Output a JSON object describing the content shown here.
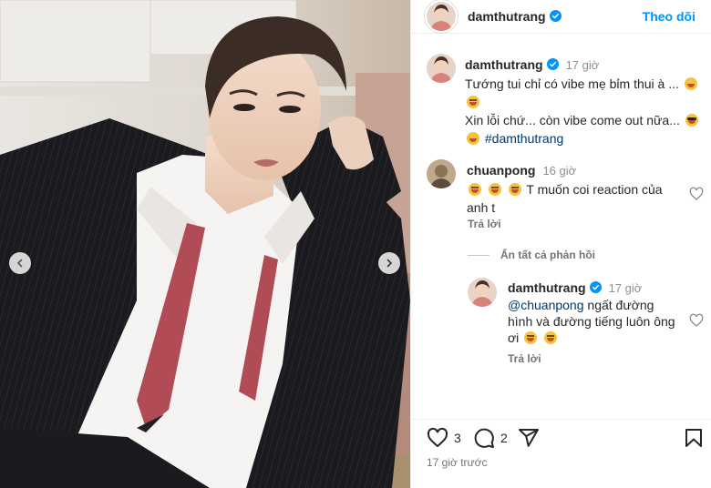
{
  "header": {
    "username": "damthutrang",
    "follow_label": "Theo dõi"
  },
  "caption": {
    "username": "damthutrang",
    "time": "17 giờ",
    "line1": "Tướng tui chỉ có vibe mẹ bỉm thui à ...",
    "line2": "Xin lỗi chứ... còn vibe come out nữa...",
    "hashtag": "#damthutrang"
  },
  "comments": [
    {
      "username": "chuanpong",
      "time": "16 giờ",
      "text": "T muốn coi reaction của anh t",
      "reply_label": "Trả lời"
    },
    {
      "username": "damthutrang",
      "time": "17 giờ",
      "mention": "@chuanpong",
      "text": "ngất đường hình và đường tiếng luôn ông ơi",
      "reply_label": "Trả lời"
    }
  ],
  "hide_replies_label": "Ẩn tất cả phản hồi",
  "actions": {
    "like_count": "3",
    "comment_count": "2"
  },
  "posted_ago": "17 giờ trước",
  "icons": {
    "verified": "verified-badge-icon",
    "like": "heart-icon",
    "comment": "comment-bubble-icon",
    "share": "paper-plane-icon",
    "save": "bookmark-icon",
    "prev": "chevron-left-icon",
    "next": "chevron-right-icon"
  },
  "colors": {
    "link_blue": "#0095f6",
    "verified_blue": "#0095f6",
    "hashtag": "#00376b",
    "secondary_text": "#737373"
  }
}
